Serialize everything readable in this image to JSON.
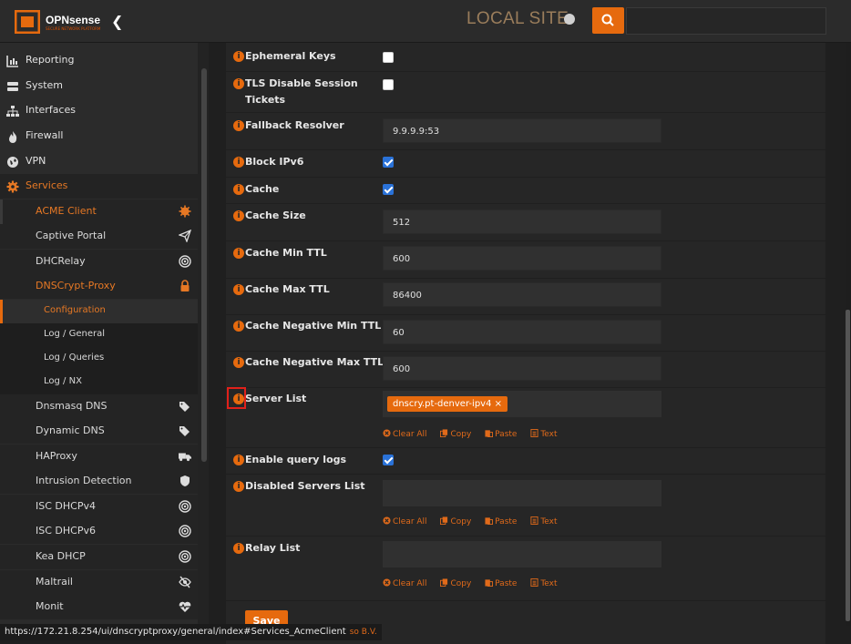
{
  "header": {
    "brand": "OPNsense",
    "brand_sub": "SECURE NETWORK PLATFORM",
    "site_label": "LOCAL SITE",
    "search_placeholder": ""
  },
  "sidebar": {
    "items": [
      {
        "label": "Reporting",
        "icon": "chart-icon"
      },
      {
        "label": "System",
        "icon": "server-icon"
      },
      {
        "label": "Interfaces",
        "icon": "sitemap-icon"
      },
      {
        "label": "Firewall",
        "icon": "fire-icon"
      },
      {
        "label": "VPN",
        "icon": "globe-icon"
      },
      {
        "label": "Services",
        "icon": "gear-icon"
      }
    ],
    "services": [
      {
        "label": "ACME Client",
        "icon": "certificate-icon"
      },
      {
        "label": "Captive Portal",
        "icon": "paper-plane-icon"
      },
      {
        "label": "DHCRelay",
        "icon": "bullseye-icon"
      },
      {
        "label": "DNSCrypt-Proxy",
        "icon": "lock-icon"
      }
    ],
    "dnscrypt_sub": [
      {
        "label": "Configuration"
      },
      {
        "label": "Log / General"
      },
      {
        "label": "Log / Queries"
      },
      {
        "label": "Log / NX"
      }
    ],
    "more_services": [
      {
        "label": "Dnsmasq DNS",
        "icon": "tags-icon"
      },
      {
        "label": "Dynamic DNS",
        "icon": "tags-icon"
      },
      {
        "label": "HAProxy",
        "icon": "truck-icon"
      },
      {
        "label": "Intrusion Detection",
        "icon": "shield-icon"
      },
      {
        "label": "ISC DHCPv4",
        "icon": "bullseye-icon"
      },
      {
        "label": "ISC DHCPv6",
        "icon": "bullseye-icon"
      },
      {
        "label": "Kea DHCP",
        "icon": "bullseye-icon"
      },
      {
        "label": "Maltrail",
        "icon": "eye-slash-icon"
      },
      {
        "label": "Monit",
        "icon": "heartbeat-icon"
      }
    ]
  },
  "form": {
    "ephemeral_keys": {
      "label": "Ephemeral Keys",
      "checked": false
    },
    "tls_disable": {
      "label": "TLS Disable Session Tickets",
      "checked": false
    },
    "fallback_resolver": {
      "label": "Fallback Resolver",
      "value": "9.9.9.9:53"
    },
    "block_ipv6": {
      "label": "Block IPv6",
      "checked": true
    },
    "cache": {
      "label": "Cache",
      "checked": true
    },
    "cache_size": {
      "label": "Cache Size",
      "value": "512"
    },
    "cache_min_ttl": {
      "label": "Cache Min TTL",
      "value": "600"
    },
    "cache_max_ttl": {
      "label": "Cache Max TTL",
      "value": "86400"
    },
    "cache_neg_min_ttl": {
      "label": "Cache Negative Min TTL",
      "value": "60"
    },
    "cache_neg_max_ttl": {
      "label": "Cache Negative Max TTL",
      "value": "600"
    },
    "server_list": {
      "label": "Server List",
      "tokens": [
        "dnscry.pt-denver-ipv4"
      ]
    },
    "enable_query_logs": {
      "label": "Enable query logs",
      "checked": true
    },
    "disabled_servers": {
      "label": "Disabled Servers List"
    },
    "relay_list": {
      "label": "Relay List"
    },
    "tools": {
      "clear_all": "Clear All",
      "copy": "Copy",
      "paste": "Paste",
      "text": "Text"
    },
    "save_label": "Save",
    "info_glyph": "i",
    "token_remove": "×"
  },
  "status_bar": {
    "url": "https://172.21.8.254/ui/dnscryptproxy/general/index#Services_AcmeClient",
    "tail": "so B.V."
  },
  "colors": {
    "accent": "#e66a0e",
    "background": "#1f1f1f",
    "panel": "#262626",
    "sidebar": "#2b2b2b"
  }
}
